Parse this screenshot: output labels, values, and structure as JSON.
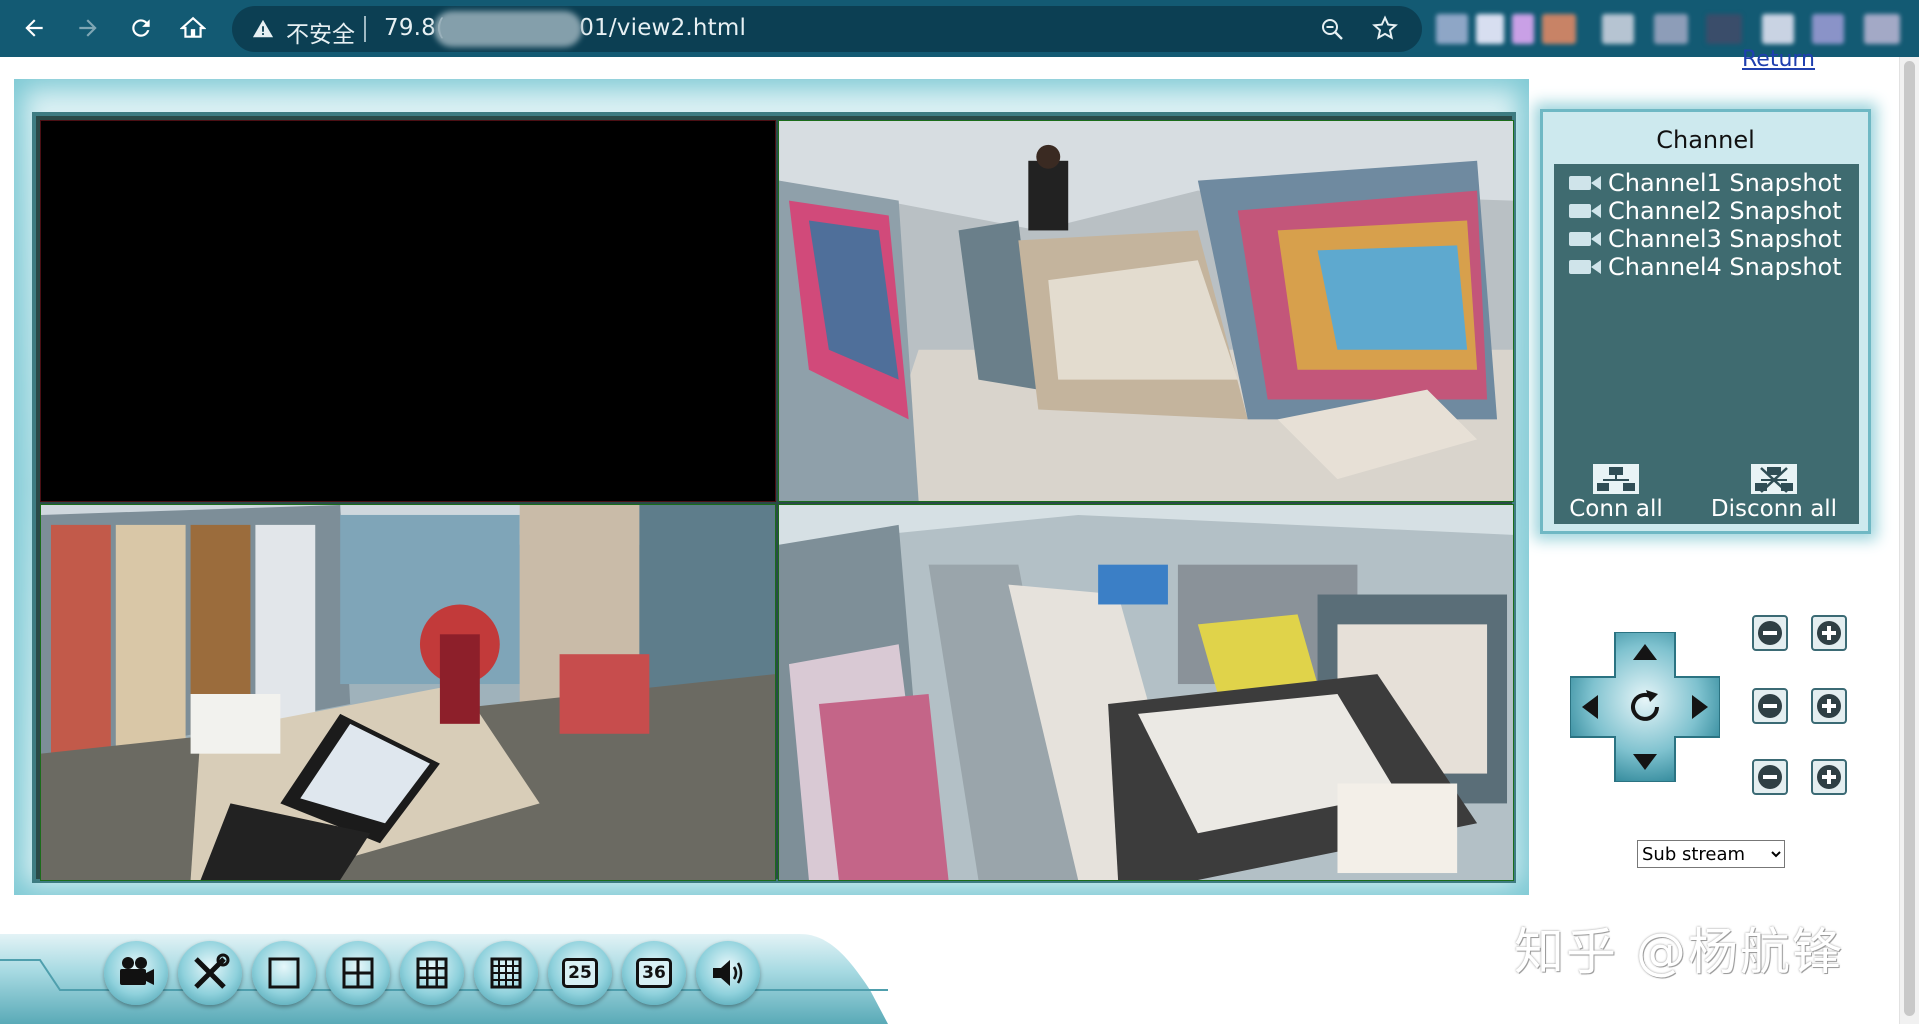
{
  "browser": {
    "insecure_label": "不安全",
    "url_prefix": "79.8(",
    "url_suffix": "01/view2.html"
  },
  "page": {
    "return_link": "Return"
  },
  "channel_panel": {
    "title": "Channel",
    "items": [
      {
        "label": "Channel1 Snapshot"
      },
      {
        "label": "Channel2 Snapshot"
      },
      {
        "label": "Channel3 Snapshot"
      },
      {
        "label": "Channel4 Snapshot"
      }
    ],
    "conn_all": "Conn all",
    "disconn_all": "Disconn all"
  },
  "stream": {
    "selected": "Sub stream"
  },
  "toolbar": {
    "buttons": [
      {
        "icon": "video-camera-icon"
      },
      {
        "icon": "tools-icon"
      },
      {
        "icon": "single-view-icon"
      },
      {
        "icon": "quad-view-icon"
      },
      {
        "icon": "nine-view-icon"
      },
      {
        "icon": "sixteen-view-icon"
      },
      {
        "icon": "twenty-five-view-icon",
        "label": "25"
      },
      {
        "icon": "thirty-six-view-icon",
        "label": "36"
      },
      {
        "icon": "speaker-icon"
      }
    ]
  },
  "watermark": "知乎 @杨航锋",
  "colors": {
    "browser_bar": "#135a73",
    "channel_list_bg": "#3f6b70",
    "frame_glow": "#7ec9d4"
  }
}
